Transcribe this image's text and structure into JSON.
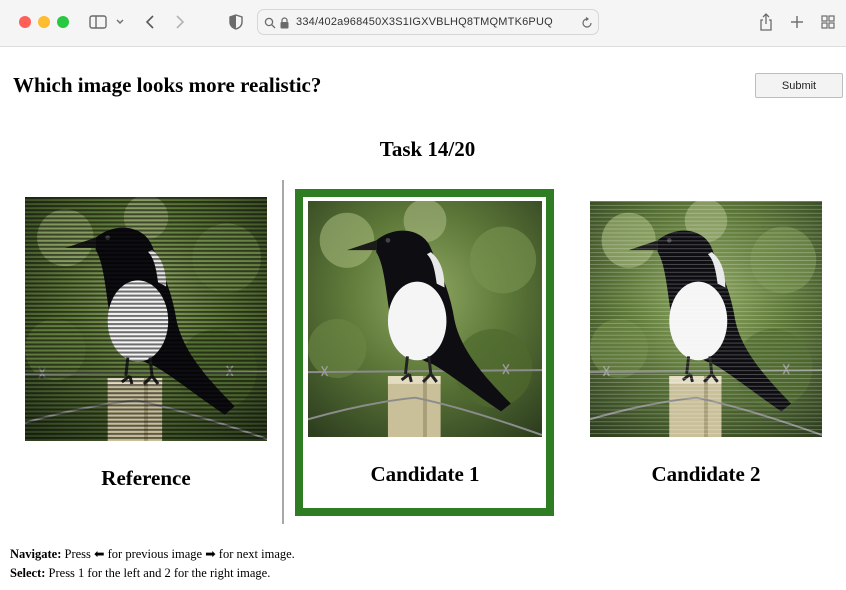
{
  "browser": {
    "url": "334/402a968450X3S1IGXVBLHQ8TMQMTK6PUQ",
    "icons": [
      "sidebar-icon",
      "chevron-down-icon",
      "back-icon",
      "forward-icon",
      "shield-icon",
      "search-icon",
      "lock-icon",
      "reload-icon",
      "share-icon",
      "plus-icon",
      "tabs-grid-icon"
    ]
  },
  "page": {
    "title": "Which image looks more realistic?",
    "submit_label": "Submit",
    "task_label": "Task 14/20"
  },
  "images": {
    "reference": "Reference",
    "candidate1": "Candidate 1",
    "candidate2": "Candidate 2",
    "selected": "candidate1"
  },
  "help": {
    "navigate_label": "Navigate:",
    "navigate_text_1": "Press",
    "left_arrow": "⬅",
    "navigate_text_2": "for previous image",
    "right_arrow": "➡",
    "navigate_text_3": "for next image.",
    "select_label": "Select:",
    "select_text": "Press 1 for the left and 2 for the right image."
  },
  "colors": {
    "selection_border": "#2f7d23",
    "divider": "#a8a8a8"
  }
}
